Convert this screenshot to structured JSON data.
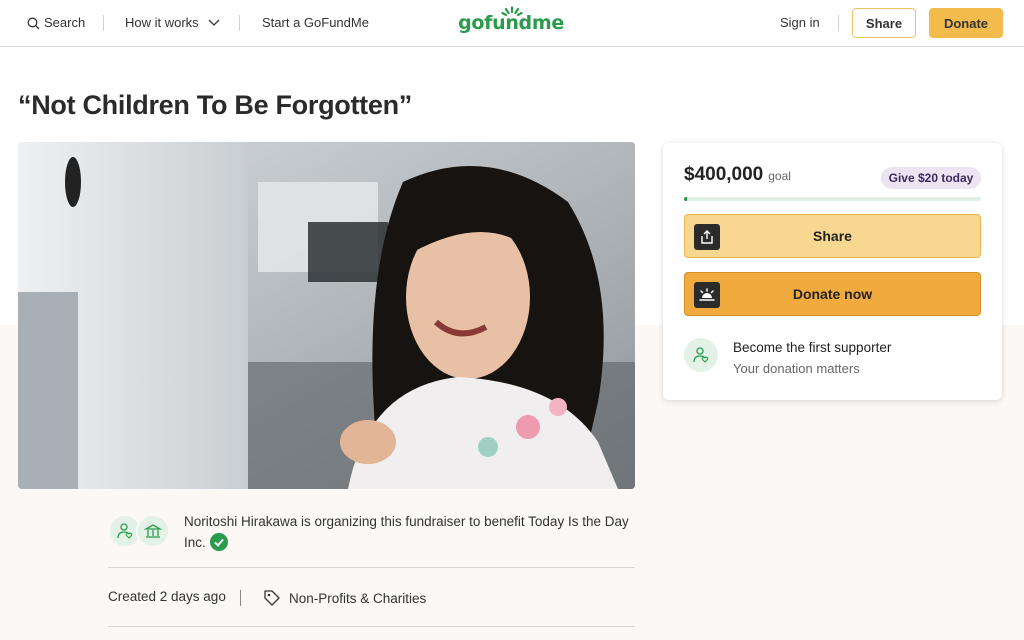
{
  "header": {
    "search_label": "Search",
    "how_it_works_label": "How it works",
    "start_label": "Start a GoFundMe",
    "logo_text": "gofundme",
    "sign_in_label": "Sign in",
    "share_label": "Share",
    "donate_label": "Donate"
  },
  "campaign": {
    "title": "“Not Children To Be Forgotten”",
    "organizer_text": "Noritoshi Hirakawa is organizing this fundraiser to benefit Today Is the Day Inc.",
    "created": "Created 2 days ago",
    "category": "Non-Profits & Charities"
  },
  "donation_card": {
    "goal_amount": "$400,000",
    "goal_label": "goal",
    "give_badge": "Give $20 today",
    "progress_fraction": 0.01,
    "share_button": "Share",
    "donate_button": "Donate now",
    "supporter_title": "Become the first supporter",
    "supporter_subtitle": "Your donation matters"
  },
  "colors": {
    "brand_green": "#2a9b4d",
    "donate_yellow": "#f3bb4c",
    "card_share": "#f8d891",
    "card_donate": "#f1aa3e",
    "badge_purple": "#ece4f3"
  },
  "icons": {
    "search": "search-icon",
    "chevron": "chevron-down-icon",
    "logo_sun": "sun-icon",
    "share": "upload-icon",
    "donate": "sunrise-icon",
    "supporter": "heart-hand-icon",
    "organizer": "person-heart-icon",
    "charity": "bank-icon",
    "verified": "check-icon",
    "category": "tag-icon"
  }
}
